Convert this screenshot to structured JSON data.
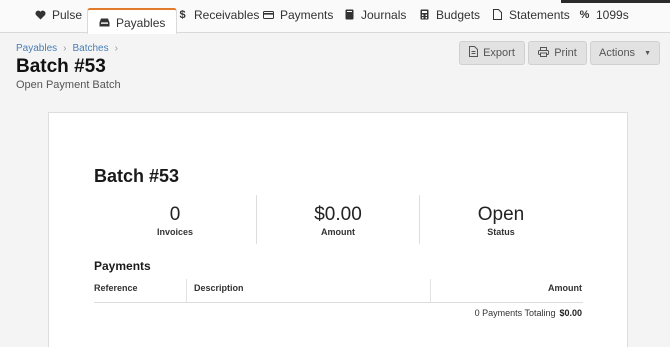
{
  "nav": {
    "tabs": [
      {
        "label": "Pulse",
        "icon": "heart-icon"
      },
      {
        "label": "Payables",
        "icon": "inbox-icon",
        "active": true
      },
      {
        "label": "Receivables",
        "icon": "dollar-icon"
      },
      {
        "label": "Payments",
        "icon": "credit-card-icon"
      },
      {
        "label": "Journals",
        "icon": "book-icon"
      },
      {
        "label": "Budgets",
        "icon": "calculator-icon"
      },
      {
        "label": "Statements",
        "icon": "document-icon"
      },
      {
        "label": "1099s",
        "icon": "percent-icon"
      }
    ]
  },
  "breadcrumb": {
    "items": [
      "Payables",
      "Batches"
    ]
  },
  "page": {
    "title": "Batch #53",
    "subtitle": "Open Payment Batch"
  },
  "toolbar": {
    "export_label": "Export",
    "print_label": "Print",
    "actions_label": "Actions"
  },
  "card": {
    "title": "Batch #53",
    "stats": [
      {
        "value": "0",
        "label": "Invoices"
      },
      {
        "value": "$0.00",
        "label": "Amount"
      },
      {
        "value": "Open",
        "label": "Status"
      }
    ],
    "payments": {
      "heading": "Payments",
      "columns": [
        "Reference",
        "Description",
        "Amount"
      ],
      "summary_text": "0 Payments Totaling",
      "summary_amount": "$0.00"
    }
  },
  "colors": {
    "accent": "#e27a2c",
    "link": "#4a7fb5",
    "button_bg": "#e2e2e2"
  }
}
